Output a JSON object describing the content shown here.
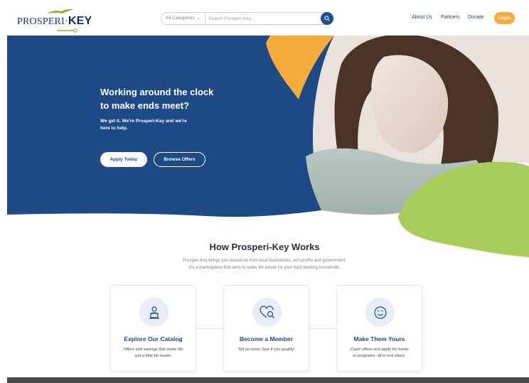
{
  "header": {
    "logo": {
      "text_main": "PROSPERI",
      "text_sep": "·",
      "text_key": "KEY"
    },
    "search": {
      "category_label": "All Categories",
      "placeholder": "Search Prosperi-Key..."
    },
    "nav": {
      "about": "About Us",
      "partners": "Partners",
      "donate": "Donate",
      "login": "Login"
    }
  },
  "hero": {
    "title_line1": "Working around the clock",
    "title_line2": "to make ends meet?",
    "subtitle_line1": "We get it. We're Prosperi-Key and we're",
    "subtitle_line2": "here to help.",
    "apply_label": "Apply Today",
    "browse_label": "Browse Offers"
  },
  "how": {
    "title": "How Prosperi-Key Works",
    "desc_line1": "Prosperi-Key brings you resources from local businesses, non-profits and government.",
    "desc_line2": "It's a marketplace that aims to make life easier for your hard working household.",
    "cards": [
      {
        "title": "Explore Our Catalog",
        "text_line1": "Offers and savings that make life",
        "text_line2": "just a little bit easier."
      },
      {
        "title": "Become a Member",
        "text_line1": "Tell us more. See if you qualify!",
        "text_line2": ""
      },
      {
        "title": "Make Them Yours",
        "text_line1": "Claim offers and apply for funds",
        "text_line2": "or programs, all in one place."
      }
    ]
  },
  "colors": {
    "brand_blue": "#1d4a86",
    "accent_orange": "#f4ac3d",
    "accent_green": "#a8cd5a"
  },
  "icons": {
    "search": "search-icon",
    "catalog": "person-laptop-icon",
    "member": "heart-search-icon",
    "yours": "smiley-icon"
  }
}
